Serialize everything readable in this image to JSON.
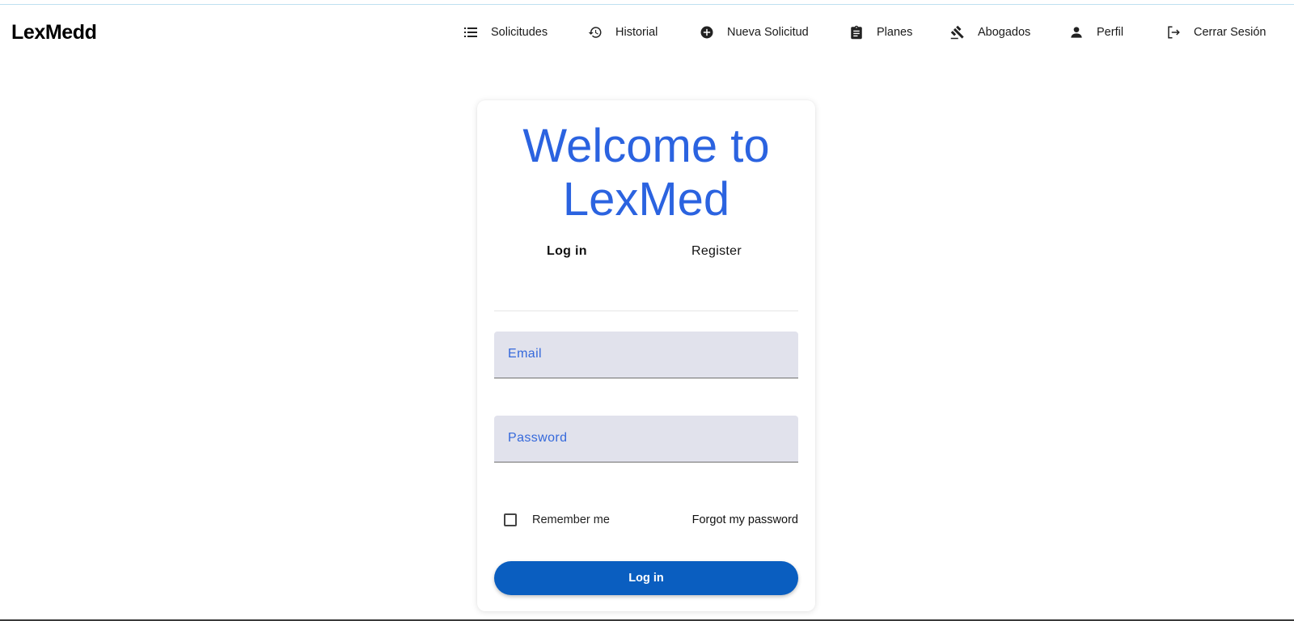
{
  "brand": {
    "name": "LexMedd"
  },
  "nav": {
    "items": [
      {
        "label": "Solicitudes",
        "icon": "list-icon"
      },
      {
        "label": "Historial",
        "icon": "history-icon"
      },
      {
        "label": "Nueva Solicitud",
        "icon": "add-circle-icon"
      },
      {
        "label": "Planes",
        "icon": "clipboard-icon"
      },
      {
        "label": "Abogados",
        "icon": "gavel-icon"
      },
      {
        "label": "Perfil",
        "icon": "person-icon"
      },
      {
        "label": "Cerrar Sesión",
        "icon": "logout-icon"
      }
    ]
  },
  "login": {
    "title_line1": "Welcome to",
    "title_line2": "LexMed",
    "tabs": [
      {
        "label": "Log in",
        "active": true
      },
      {
        "label": "Register",
        "active": false
      }
    ],
    "email": {
      "placeholder": "Email",
      "value": ""
    },
    "password": {
      "placeholder": "Password",
      "value": ""
    },
    "remember_label": "Remember me",
    "remember_checked": false,
    "forgot_label": "Forgot my password",
    "submit_label": "Log in"
  },
  "colors": {
    "title": "#2b63e0",
    "field_bg": "#e1e2ec",
    "field_placeholder": "#3569db",
    "button_bg": "#0a5ec0"
  }
}
